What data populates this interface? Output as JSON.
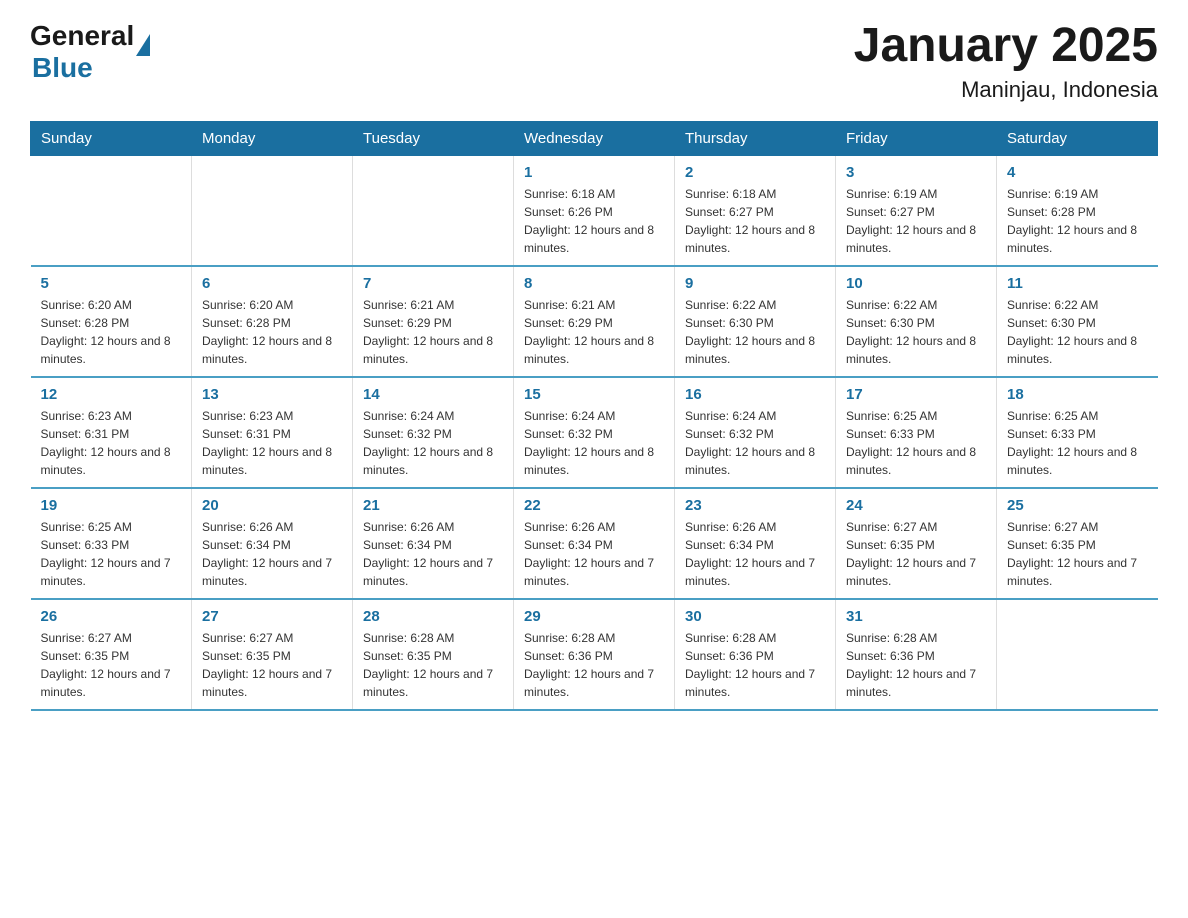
{
  "logo": {
    "text_general": "General",
    "text_blue": "Blue"
  },
  "title": "January 2025",
  "subtitle": "Maninjau, Indonesia",
  "days_of_week": [
    "Sunday",
    "Monday",
    "Tuesday",
    "Wednesday",
    "Thursday",
    "Friday",
    "Saturday"
  ],
  "weeks": [
    [
      {
        "day": "",
        "info": ""
      },
      {
        "day": "",
        "info": ""
      },
      {
        "day": "",
        "info": ""
      },
      {
        "day": "1",
        "info": "Sunrise: 6:18 AM\nSunset: 6:26 PM\nDaylight: 12 hours and 8 minutes."
      },
      {
        "day": "2",
        "info": "Sunrise: 6:18 AM\nSunset: 6:27 PM\nDaylight: 12 hours and 8 minutes."
      },
      {
        "day": "3",
        "info": "Sunrise: 6:19 AM\nSunset: 6:27 PM\nDaylight: 12 hours and 8 minutes."
      },
      {
        "day": "4",
        "info": "Sunrise: 6:19 AM\nSunset: 6:28 PM\nDaylight: 12 hours and 8 minutes."
      }
    ],
    [
      {
        "day": "5",
        "info": "Sunrise: 6:20 AM\nSunset: 6:28 PM\nDaylight: 12 hours and 8 minutes."
      },
      {
        "day": "6",
        "info": "Sunrise: 6:20 AM\nSunset: 6:28 PM\nDaylight: 12 hours and 8 minutes."
      },
      {
        "day": "7",
        "info": "Sunrise: 6:21 AM\nSunset: 6:29 PM\nDaylight: 12 hours and 8 minutes."
      },
      {
        "day": "8",
        "info": "Sunrise: 6:21 AM\nSunset: 6:29 PM\nDaylight: 12 hours and 8 minutes."
      },
      {
        "day": "9",
        "info": "Sunrise: 6:22 AM\nSunset: 6:30 PM\nDaylight: 12 hours and 8 minutes."
      },
      {
        "day": "10",
        "info": "Sunrise: 6:22 AM\nSunset: 6:30 PM\nDaylight: 12 hours and 8 minutes."
      },
      {
        "day": "11",
        "info": "Sunrise: 6:22 AM\nSunset: 6:30 PM\nDaylight: 12 hours and 8 minutes."
      }
    ],
    [
      {
        "day": "12",
        "info": "Sunrise: 6:23 AM\nSunset: 6:31 PM\nDaylight: 12 hours and 8 minutes."
      },
      {
        "day": "13",
        "info": "Sunrise: 6:23 AM\nSunset: 6:31 PM\nDaylight: 12 hours and 8 minutes."
      },
      {
        "day": "14",
        "info": "Sunrise: 6:24 AM\nSunset: 6:32 PM\nDaylight: 12 hours and 8 minutes."
      },
      {
        "day": "15",
        "info": "Sunrise: 6:24 AM\nSunset: 6:32 PM\nDaylight: 12 hours and 8 minutes."
      },
      {
        "day": "16",
        "info": "Sunrise: 6:24 AM\nSunset: 6:32 PM\nDaylight: 12 hours and 8 minutes."
      },
      {
        "day": "17",
        "info": "Sunrise: 6:25 AM\nSunset: 6:33 PM\nDaylight: 12 hours and 8 minutes."
      },
      {
        "day": "18",
        "info": "Sunrise: 6:25 AM\nSunset: 6:33 PM\nDaylight: 12 hours and 8 minutes."
      }
    ],
    [
      {
        "day": "19",
        "info": "Sunrise: 6:25 AM\nSunset: 6:33 PM\nDaylight: 12 hours and 7 minutes."
      },
      {
        "day": "20",
        "info": "Sunrise: 6:26 AM\nSunset: 6:34 PM\nDaylight: 12 hours and 7 minutes."
      },
      {
        "day": "21",
        "info": "Sunrise: 6:26 AM\nSunset: 6:34 PM\nDaylight: 12 hours and 7 minutes."
      },
      {
        "day": "22",
        "info": "Sunrise: 6:26 AM\nSunset: 6:34 PM\nDaylight: 12 hours and 7 minutes."
      },
      {
        "day": "23",
        "info": "Sunrise: 6:26 AM\nSunset: 6:34 PM\nDaylight: 12 hours and 7 minutes."
      },
      {
        "day": "24",
        "info": "Sunrise: 6:27 AM\nSunset: 6:35 PM\nDaylight: 12 hours and 7 minutes."
      },
      {
        "day": "25",
        "info": "Sunrise: 6:27 AM\nSunset: 6:35 PM\nDaylight: 12 hours and 7 minutes."
      }
    ],
    [
      {
        "day": "26",
        "info": "Sunrise: 6:27 AM\nSunset: 6:35 PM\nDaylight: 12 hours and 7 minutes."
      },
      {
        "day": "27",
        "info": "Sunrise: 6:27 AM\nSunset: 6:35 PM\nDaylight: 12 hours and 7 minutes."
      },
      {
        "day": "28",
        "info": "Sunrise: 6:28 AM\nSunset: 6:35 PM\nDaylight: 12 hours and 7 minutes."
      },
      {
        "day": "29",
        "info": "Sunrise: 6:28 AM\nSunset: 6:36 PM\nDaylight: 12 hours and 7 minutes."
      },
      {
        "day": "30",
        "info": "Sunrise: 6:28 AM\nSunset: 6:36 PM\nDaylight: 12 hours and 7 minutes."
      },
      {
        "day": "31",
        "info": "Sunrise: 6:28 AM\nSunset: 6:36 PM\nDaylight: 12 hours and 7 minutes."
      },
      {
        "day": "",
        "info": ""
      }
    ]
  ]
}
